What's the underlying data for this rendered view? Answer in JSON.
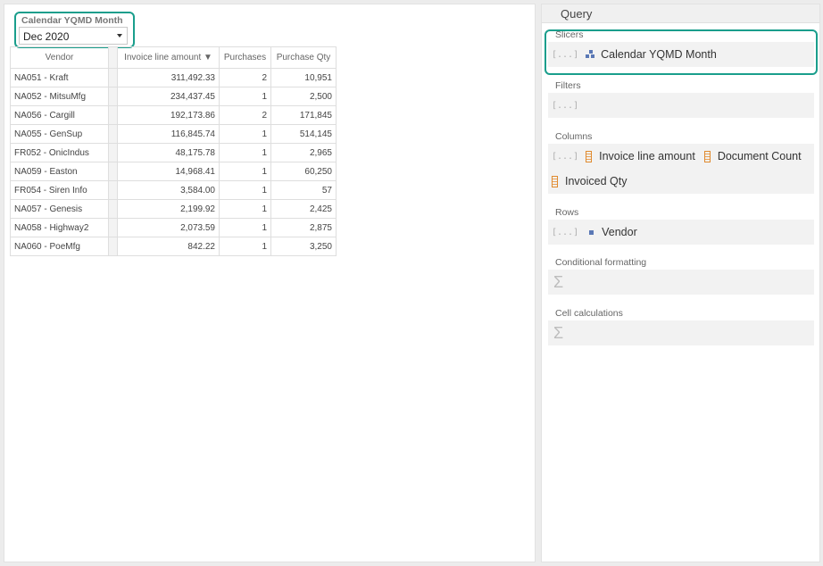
{
  "slicer": {
    "title": "Calendar YQMD Month",
    "selected": "Dec 2020"
  },
  "grid": {
    "headers": {
      "vendor": "Vendor",
      "amount": "Invoice line amount ▼",
      "purchases": "Purchases",
      "qty": "Purchase Qty"
    },
    "rows": [
      {
        "vendor": "NA051 - Kraft",
        "amount": "311,492.33",
        "purchases": "2",
        "qty": "10,951"
      },
      {
        "vendor": "NA052 - MitsuMfg",
        "amount": "234,437.45",
        "purchases": "1",
        "qty": "2,500"
      },
      {
        "vendor": "NA056 - Cargill",
        "amount": "192,173.86",
        "purchases": "2",
        "qty": "171,845"
      },
      {
        "vendor": "NA055 - GenSup",
        "amount": "116,845.74",
        "purchases": "1",
        "qty": "514,145"
      },
      {
        "vendor": "FR052 - OnicIndus",
        "amount": "48,175.78",
        "purchases": "1",
        "qty": "2,965"
      },
      {
        "vendor": "NA059 - Easton",
        "amount": "14,968.41",
        "purchases": "1",
        "qty": "60,250"
      },
      {
        "vendor": "FR054 - Siren Info",
        "amount": "3,584.00",
        "purchases": "1",
        "qty": "57"
      },
      {
        "vendor": "NA057 - Genesis",
        "amount": "2,199.92",
        "purchases": "1",
        "qty": "2,425"
      },
      {
        "vendor": "NA058 - Highway2",
        "amount": "2,073.59",
        "purchases": "1",
        "qty": "2,875"
      },
      {
        "vendor": "NA060 - PoeMfg",
        "amount": "842.22",
        "purchases": "1",
        "qty": "3,250"
      }
    ]
  },
  "query": {
    "title": "Query",
    "bracket": "[...]",
    "sigma": "Σ",
    "slicers_label": "Slicers",
    "slicers_item": "Calendar YQMD Month",
    "filters_label": "Filters",
    "columns_label": "Columns",
    "columns_items": [
      "Invoice line amount",
      "Document Count",
      "Invoiced Qty"
    ],
    "rows_label": "Rows",
    "rows_item": "Vendor",
    "cond_label": "Conditional formatting",
    "calc_label": "Cell calculations"
  },
  "colors": {
    "highlight": "#1a9e8c",
    "measure": "#e08a2e",
    "dimension": "#5a78b5"
  },
  "icons": [
    "bracket-icon",
    "hierarchy-icon",
    "measure-icon",
    "dimension-icon",
    "sigma-icon",
    "caret-down-icon"
  ]
}
